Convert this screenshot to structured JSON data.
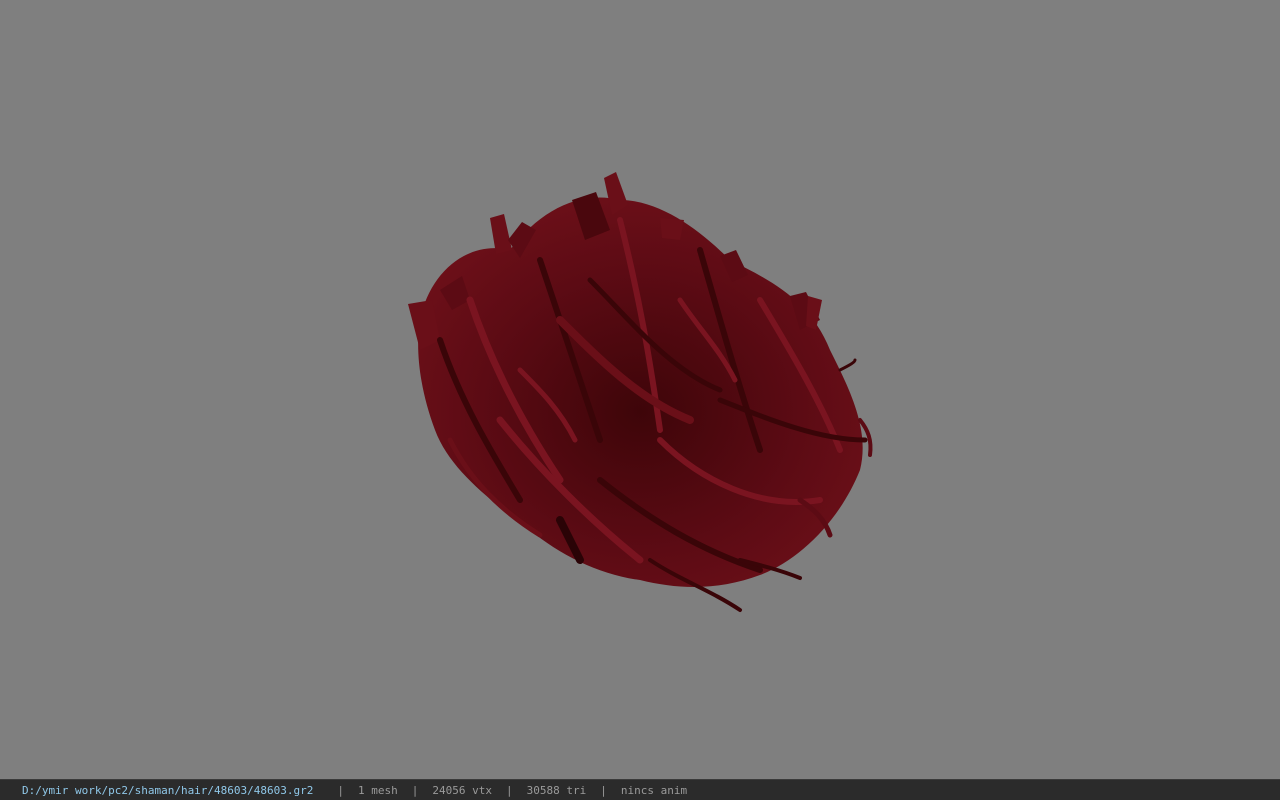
{
  "viewport": {
    "background_color": "#7f7f7f",
    "model_color": "#5a0a12",
    "model_description": "hair-mesh"
  },
  "status_bar": {
    "file_path": "D:/ymir work/pc2/shaman/hair/48603/48603.gr2",
    "separator": "|",
    "mesh_count": "1 mesh",
    "vertex_count": "24056 vtx",
    "triangle_count": "30588 tri",
    "anim_status": "nincs anim"
  }
}
